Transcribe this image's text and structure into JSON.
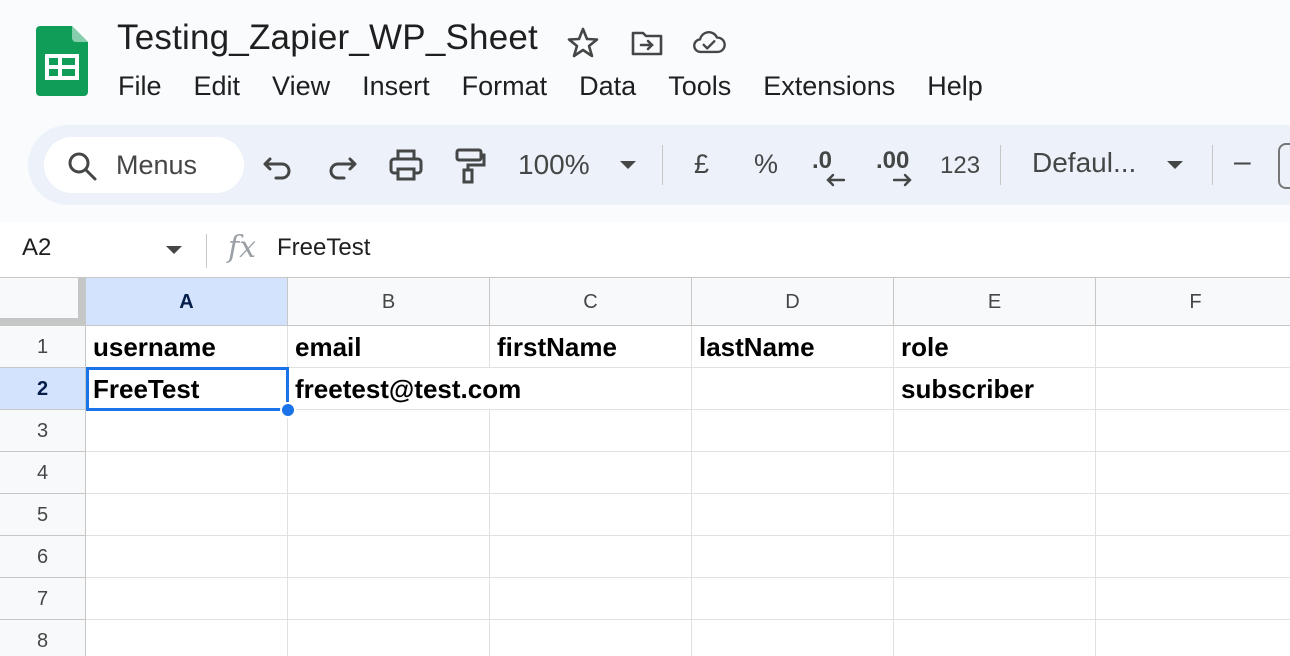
{
  "document": {
    "title": "Testing_Zapier_WP_Sheet"
  },
  "menubar": {
    "items": [
      "File",
      "Edit",
      "View",
      "Insert",
      "Format",
      "Data",
      "Tools",
      "Extensions",
      "Help"
    ]
  },
  "toolbar": {
    "search_label": "Menus",
    "zoom": "100%",
    "currency_symbol": "£",
    "percent_symbol": "%",
    "decrease_decimal": ".0",
    "increase_decimal": ".00",
    "number_format": "123",
    "font": "Defaul...",
    "decrease_font_size": "–"
  },
  "formula_bar": {
    "name_box": "A2",
    "fx": "fx",
    "value": "FreeTest"
  },
  "sheet": {
    "columns": [
      "A",
      "B",
      "C",
      "D",
      "E",
      "F"
    ],
    "rows": [
      "1",
      "2",
      "3",
      "4",
      "5",
      "6",
      "7",
      "8"
    ],
    "active_cell": "A2",
    "cells": {
      "A1": "username",
      "B1": "email",
      "C1": "firstName",
      "D1": "lastName",
      "E1": "role",
      "A2": "FreeTest",
      "B2": "freetest@test.com",
      "E2": "subscriber"
    }
  },
  "colors": {
    "accent": "#1a73e8",
    "sheets_green": "#0f9d58",
    "selected_header": "#d3e3fd"
  }
}
